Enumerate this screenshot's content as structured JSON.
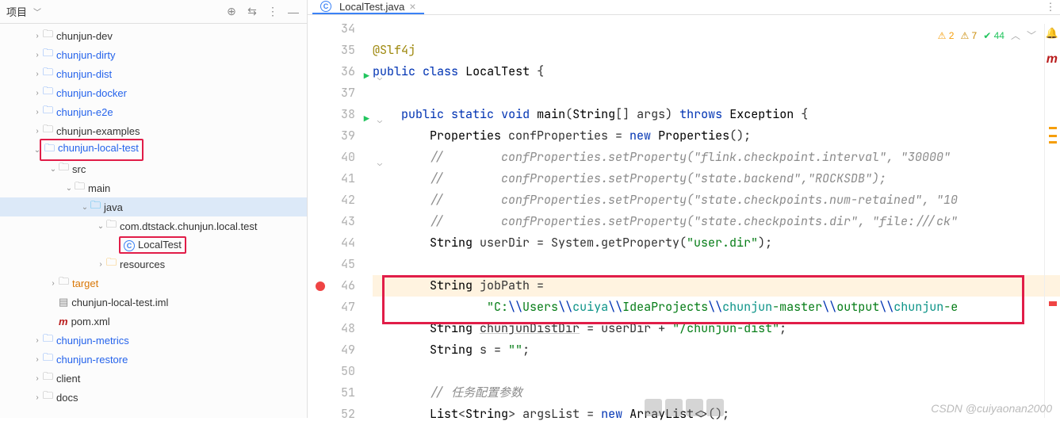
{
  "sidebar": {
    "title": "项目",
    "tree": [
      {
        "indent": 40,
        "arrow": ">",
        "icon": "folder",
        "label": "chunjun-dev"
      },
      {
        "indent": 40,
        "arrow": ">",
        "icon": "folder-blue",
        "label": "chunjun-dirty",
        "labelClass": "blue"
      },
      {
        "indent": 40,
        "arrow": ">",
        "icon": "folder-blue",
        "label": "chunjun-dist",
        "labelClass": "blue"
      },
      {
        "indent": 40,
        "arrow": ">",
        "icon": "folder-blue",
        "label": "chunjun-docker",
        "labelClass": "blue"
      },
      {
        "indent": 40,
        "arrow": ">",
        "icon": "folder-blue",
        "label": "chunjun-e2e",
        "labelClass": "blue"
      },
      {
        "indent": 40,
        "arrow": ">",
        "icon": "folder",
        "label": "chunjun-examples"
      },
      {
        "indent": 40,
        "arrow": "v",
        "icon": "folder-blue",
        "label": "chunjun-local-test",
        "labelClass": "blue",
        "redbox": true
      },
      {
        "indent": 60,
        "arrow": "v",
        "icon": "folder",
        "label": "src"
      },
      {
        "indent": 80,
        "arrow": "v",
        "icon": "folder",
        "label": "main"
      },
      {
        "indent": 100,
        "arrow": "v",
        "icon": "folder-teal",
        "label": "java",
        "sel": true
      },
      {
        "indent": 120,
        "arrow": "v",
        "icon": "folder",
        "label": "com.dtstack.chunjun.local.test"
      },
      {
        "indent": 140,
        "arrow": "",
        "icon": "class",
        "label": "LocalTest",
        "redbox": true
      },
      {
        "indent": 120,
        "arrow": ">",
        "icon": "folder-orange",
        "label": "resources"
      },
      {
        "indent": 60,
        "arrow": ">",
        "icon": "folder",
        "label": "target",
        "labelClass": "orange"
      },
      {
        "indent": 60,
        "arrow": "",
        "icon": "xml",
        "label": "chunjun-local-test.iml"
      },
      {
        "indent": 60,
        "arrow": "",
        "icon": "m",
        "label": "pom.xml"
      },
      {
        "indent": 40,
        "arrow": ">",
        "icon": "folder-blue",
        "label": "chunjun-metrics",
        "labelClass": "blue"
      },
      {
        "indent": 40,
        "arrow": ">",
        "icon": "folder-blue",
        "label": "chunjun-restore",
        "labelClass": "blue"
      },
      {
        "indent": 40,
        "arrow": ">",
        "icon": "folder",
        "label": "client"
      },
      {
        "indent": 40,
        "arrow": ">",
        "icon": "folder",
        "label": "docs"
      }
    ]
  },
  "tab": {
    "file": "LocalTest.java"
  },
  "badges": {
    "err": "2",
    "warn": "7",
    "chk": "44"
  },
  "code": {
    "lines": [
      {
        "n": 34,
        "html": ""
      },
      {
        "n": 35,
        "run": false,
        "html": "<span class='ann'>@Slf4j</span>"
      },
      {
        "n": 36,
        "run": true,
        "fold": true,
        "html": "<span class='kw'>public</span> <span class='kw'>class</span> <span class='cname'>LocalTest</span> {"
      },
      {
        "n": 37,
        "html": ""
      },
      {
        "n": 38,
        "run": true,
        "fold": true,
        "html": "    <span class='kw'>public</span> <span class='kw'>static</span> <span class='kw'>void</span> <span class='fn'>main</span>(<span class='type'>String</span>[] args) <span class='kw'>throws</span> <span class='type'>Exception</span> {"
      },
      {
        "n": 39,
        "html": "        <span class='type'>Properties</span> confProperties = <span class='newkw'>new</span> <span class='type'>Properties</span>();"
      },
      {
        "n": 40,
        "fold": true,
        "html": "        <span class='cmt'>//        confProperties.setProperty(\"flink.checkpoint.interval\", \"30000\"</span>"
      },
      {
        "n": 41,
        "html": "        <span class='cmt'>//        confProperties.setProperty(\"state.backend\",\"ROCKSDB\");</span>"
      },
      {
        "n": 42,
        "html": "        <span class='cmt'>//        confProperties.setProperty(\"state.checkpoints.num-retained\", \"10</span>"
      },
      {
        "n": 43,
        "html": "        <span class='cmt'>//        confProperties.setProperty(\"state.checkpoints.dir\", \"file:///ck\"</span>"
      },
      {
        "n": 44,
        "html": "        <span class='type'>String</span> userDir = System.getProperty(<span class='str'>\"user.dir\"</span>);"
      },
      {
        "n": 45,
        "html": ""
      },
      {
        "n": 46,
        "bp": true,
        "hl": true,
        "html": "        <span class='type'>String</span> jobPath ="
      },
      {
        "n": 47,
        "html": "                <span class='str'>\"C:</span><span class='esc'>\\\\</span><span class='str'>Users</span><span class='esc'>\\\\</span><span class='strteal'>cuiya</span><span class='esc'>\\\\</span><span class='str'>IdeaProjects</span><span class='esc'>\\\\</span><span class='strteal'>chunjun</span><span class='str'>-master</span><span class='esc'>\\\\</span><span class='str'>output</span><span class='esc'>\\\\</span><span class='strteal'>chunjun</span><span class='str'>-e</span>"
      },
      {
        "n": 48,
        "html": "        <span class='type'>String</span> <u style='text-decoration-color:#ccc'>chunjunDistDir</u> = userDir + <span class='str'>\"/chunjun-dist\"</span>;"
      },
      {
        "n": 49,
        "html": "        <span class='type'>String</span> s = <span class='str'>\"\"</span>;"
      },
      {
        "n": 50,
        "html": ""
      },
      {
        "n": 51,
        "html": "        <span class='cmt'>// 任务配置参数</span>"
      },
      {
        "n": 52,
        "html": "        <span class='type'>List</span>&lt;<span class='type'>String</span>&gt; argsList = <span class='newkw'>new</span> <span class='type'>ArrayList</span>&lt;&gt;();"
      }
    ]
  },
  "watermark": "CSDN @cuiyaonan2000"
}
